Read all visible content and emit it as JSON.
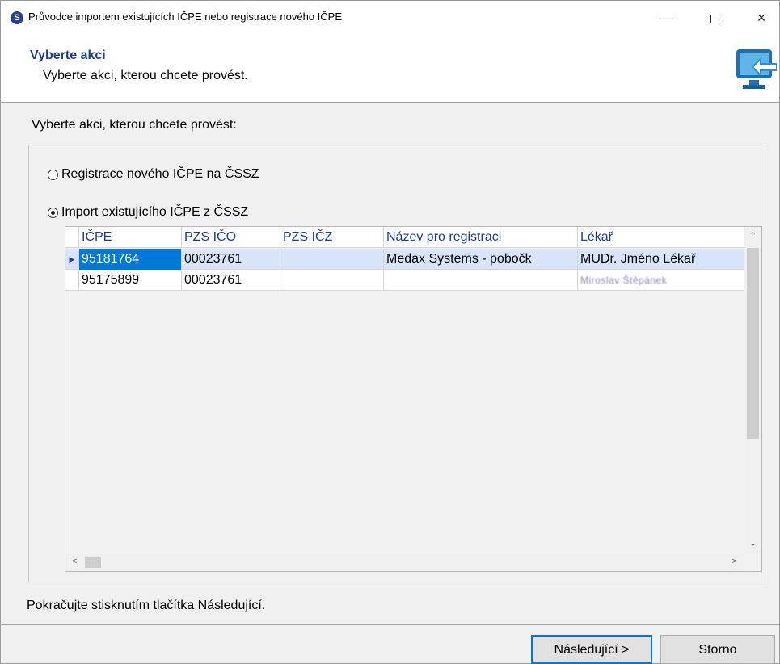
{
  "window": {
    "title": "Průvodce importem existujících IČPE nebo registrace nového IČPE",
    "app_icon_letter": "S",
    "close_glyph": "×",
    "minimize_glyph": "—"
  },
  "header": {
    "title": "Vyberte akci",
    "subtitle": "Vyberte akci, kterou chcete provést."
  },
  "body": {
    "prompt": "Vyberte akci, kterou chcete provést:",
    "options": [
      {
        "label": "Registrace nového IČPE na ČSSZ",
        "selected": false
      },
      {
        "label": "Import existujícího IČPE z ČSSZ",
        "selected": true
      }
    ]
  },
  "table": {
    "columns": [
      "IČPE",
      "PZS IČO",
      "PZS IČZ",
      "Název pro registraci",
      "Lékař"
    ],
    "rows": [
      {
        "icpe": "95181764",
        "pzs_ico": "00023761",
        "pzs_icz": "",
        "nazev": "Medax Systems - pobočk",
        "lekar": "MUDr. Jméno Lékař"
      },
      {
        "icpe": "95175899",
        "pzs_ico": "00023761",
        "pzs_icz": "",
        "nazev": "",
        "lekar": "Miroslav Štěpánek"
      }
    ],
    "selected_row": 0
  },
  "footer": {
    "hint": "Pokračujte stisknutím tlačítka Následující.",
    "next_label": "Následující >",
    "cancel_label": "Storno"
  },
  "colors": {
    "accent": "#0078d7",
    "header_title": "#1e3c8c",
    "selected_row": "#d8e5f8"
  }
}
